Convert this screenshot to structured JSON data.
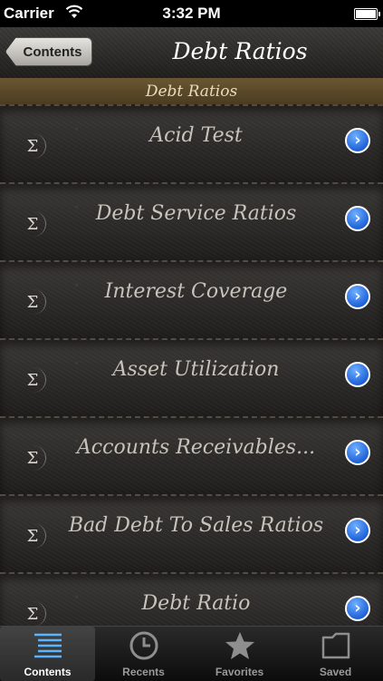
{
  "status_bar": {
    "carrier": "Carrier",
    "time": "3:32 PM"
  },
  "nav_bar": {
    "back_label": "Contents",
    "title": "Debt Ratios"
  },
  "section_header": "Debt Ratios",
  "rows": [
    {
      "label": "Acid Test",
      "icon": "sigma-icon",
      "symbol": "Σ"
    },
    {
      "label": "Debt Service Ratios",
      "icon": "sigma-icon",
      "symbol": "Σ"
    },
    {
      "label": "Interest Coverage",
      "icon": "sigma-icon",
      "symbol": "Σ"
    },
    {
      "label": "Asset Utilization",
      "icon": "sigma-icon",
      "symbol": "Σ"
    },
    {
      "label": "Accounts Receivables...",
      "icon": "sigma-icon",
      "symbol": "Σ"
    },
    {
      "label": "Bad Debt To Sales Ratios",
      "icon": "sigma-icon",
      "symbol": "Σ"
    },
    {
      "label": "Debt Ratio",
      "icon": "sigma-icon",
      "symbol": "Σ"
    }
  ],
  "disclosure_glyph": "›",
  "tabs": [
    {
      "label": "Contents",
      "icon": "list-icon",
      "active": true
    },
    {
      "label": "Recents",
      "icon": "clock-icon",
      "active": false
    },
    {
      "label": "Favorites",
      "icon": "star-icon",
      "active": false
    },
    {
      "label": "Saved",
      "icon": "folder-icon",
      "active": false
    }
  ],
  "colors": {
    "accent_blue": "#1f62d8",
    "section_header_brown": "#5a4828",
    "active_tab_icon": "#5ab4ff"
  }
}
